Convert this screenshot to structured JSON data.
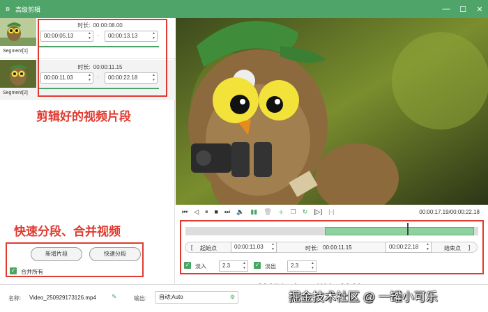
{
  "window": {
    "title": "高级剪辑",
    "logo_icon": "rabbit-logo-icon"
  },
  "window_controls": {
    "minimize": "—",
    "maximize": "☐",
    "close": "✕"
  },
  "segments": [
    {
      "label": "Segment[1]",
      "duration_label": "时长:",
      "duration": "00:00:08.00",
      "start": "00:00:05.13",
      "end": "00:00:13.13"
    },
    {
      "label": "Segment[2]",
      "duration_label": "时长:",
      "duration": "00:00:11.15",
      "start": "00:00:11.03",
      "end": "00:00:22.18"
    }
  ],
  "separator": "-",
  "annotations": {
    "clips": "剪辑好的视频片段",
    "split_merge": "快速分段、合并视频",
    "edit": "剪辑视频、增加特效"
  },
  "left_actions": {
    "add_segment": "新增片段",
    "quick_split": "快速分段",
    "merge_all": "合并所有",
    "merge_checked": true
  },
  "player": {
    "time": "00:00:17.19/00:00:22.18",
    "icons": [
      "prev-frame-icon",
      "step-back-icon",
      "pause-icon",
      "stop-icon",
      "next-frame-icon",
      "volume-icon",
      "split-icon",
      "delete-icon",
      "add-icon",
      "copy-icon",
      "refresh-icon",
      "bracket-icon",
      "crop-icon"
    ]
  },
  "editor": {
    "start_label": "起始点",
    "start_value": "00:00:11.03",
    "duration_label": "时长:",
    "duration_value": "00:00:11.15",
    "end_value": "00:00:22.18",
    "end_label": "结束点",
    "fade_in_label": "淡入",
    "fade_in_value": "2.3",
    "fade_out_label": "淡出",
    "fade_out_value": "2.3"
  },
  "footer": {
    "name_label": "名称:",
    "file_name": "Video_250929173126.mp4",
    "output_label": "输出:",
    "output_value": "自动;Auto"
  },
  "watermark": "掘金技术社区 @ 一罐小可乐",
  "colors": {
    "accent": "#4fa46a",
    "annotation": "#e03a2f"
  }
}
